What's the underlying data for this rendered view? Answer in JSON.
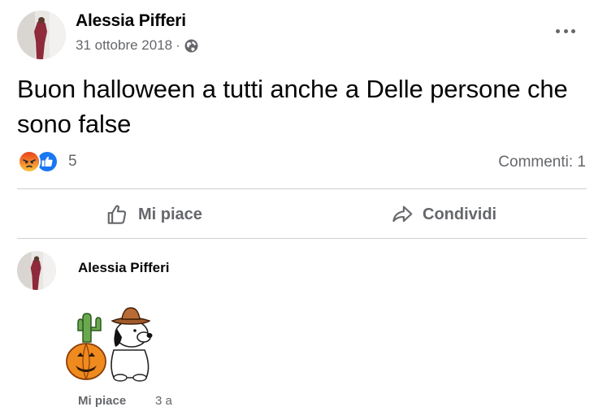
{
  "post": {
    "author": "Alessia Pifferi",
    "date": "31 ottobre 2018",
    "separator": "·",
    "privacy_icon": "globe-icon",
    "text": "Buon halloween a tutti anche a Delle persone che sono false",
    "reactions": {
      "icons": [
        "angry-reaction-icon",
        "like-reaction-icon"
      ],
      "count": "5"
    },
    "comments_label": "Commenti: 1"
  },
  "actions": {
    "like_label": "Mi piace",
    "share_label": "Condividi"
  },
  "comment": {
    "author": "Alessia Pifferi",
    "sticker": "snoopy-halloween-sticker",
    "like_label": "Mi piace",
    "time": "3 a"
  },
  "colors": {
    "secondary_text": "#65676b",
    "divider": "#ced0d4",
    "like_blue": "#1877f2",
    "angry_orange": "#f07a25"
  }
}
